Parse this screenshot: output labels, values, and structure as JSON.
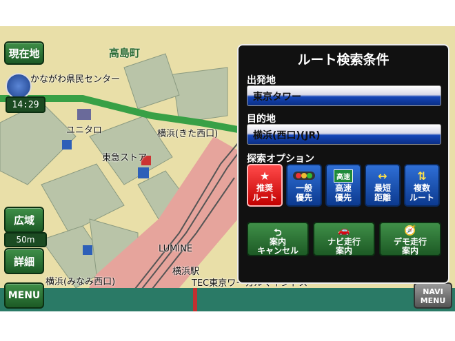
{
  "map": {
    "labels": {
      "station_area": "高島町",
      "civic_center": "かながわ県民センター",
      "yunitaro": "ユニタロ",
      "yokohama_kita": "横浜(きた西口)",
      "tokyu": "東急ストア",
      "lumine": "LUMINE",
      "yokohama_minami": "横浜(みなみ西口)",
      "tec": "TEC東京ワーカルマイントス",
      "yokohama_sta": "横浜駅"
    },
    "time": "14:29",
    "scale": "50m"
  },
  "buttons": {
    "current_location": "現在地",
    "wide": "広域",
    "detail": "詳細",
    "menu": "MENU",
    "navi_menu": "NAVI\nMENU"
  },
  "panel": {
    "title": "ルート検索条件",
    "departure_label": "出発地",
    "departure_value": "東京タワー",
    "destination_label": "目的地",
    "destination_value": "横浜(西口)(JR)",
    "options_label": "探索オプション",
    "options": [
      {
        "label": "推奨\nルート",
        "icon": "star-icon",
        "selected": true
      },
      {
        "label": "一般\n優先",
        "icon": "traffic-signal-icon",
        "selected": false
      },
      {
        "label": "高速\n優先",
        "icon": "highway-icon",
        "icon_text": "高速",
        "selected": false
      },
      {
        "label": "最短\n距離",
        "icon": "arrow-both-icon",
        "selected": false
      },
      {
        "label": "複数\nルート",
        "icon": "multi-route-icon",
        "selected": false
      }
    ],
    "actions": [
      {
        "label": "案内\nキャンセル",
        "icon": "return-icon"
      },
      {
        "label": "ナビ走行\n案内",
        "icon": "car-icon"
      },
      {
        "label": "デモ走行\n案内",
        "icon": "compass-needle-icon"
      }
    ]
  },
  "colors": {
    "selected_option": "#e00000",
    "option": "#1e55b8",
    "green_button": "#2e7a36",
    "panel_bg": "#111111"
  }
}
